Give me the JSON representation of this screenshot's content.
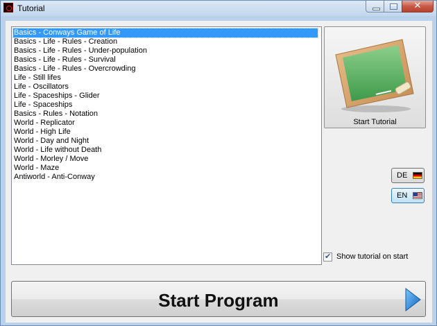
{
  "window": {
    "title": "Tutorial"
  },
  "tutorials": {
    "items": [
      "Basics - Conways Game of Life",
      "Basics - Life - Rules - Creation",
      "Basics - Life - Rules - Under-population",
      "Basics - Life - Rules - Survival",
      "Basics - Life - Rules - Overcrowding",
      "Life - Still lifes",
      "Life - Oscillators",
      "Life - Spaceships - Glider",
      "Life - Spaceships",
      "Basics - Rules - Notation",
      "World - Replicator",
      "World - High Life",
      "World - Day and Night",
      "World - Life without Death",
      "World - Morley / Move",
      "World - Maze",
      "Antiworld - Anti-Conway"
    ],
    "selected_index": 0
  },
  "start_tutorial": {
    "label": "Start Tutorial",
    "icon": "chalkboard-icon"
  },
  "languages": [
    {
      "code": "DE",
      "flag": "german-flag-icon",
      "active": false
    },
    {
      "code": "EN",
      "flag": "us-flag-icon",
      "active": true
    }
  ],
  "show_on_start": {
    "label": "Show tutorial on start",
    "checked": true
  },
  "start_program": {
    "label": "Start Program",
    "icon": "play-arrow-icon"
  },
  "colors": {
    "selection": "#3399ff",
    "window_frame": "#b9d1ea",
    "close_button": "#c75a47",
    "play_arrow": "#1e7fd8"
  }
}
